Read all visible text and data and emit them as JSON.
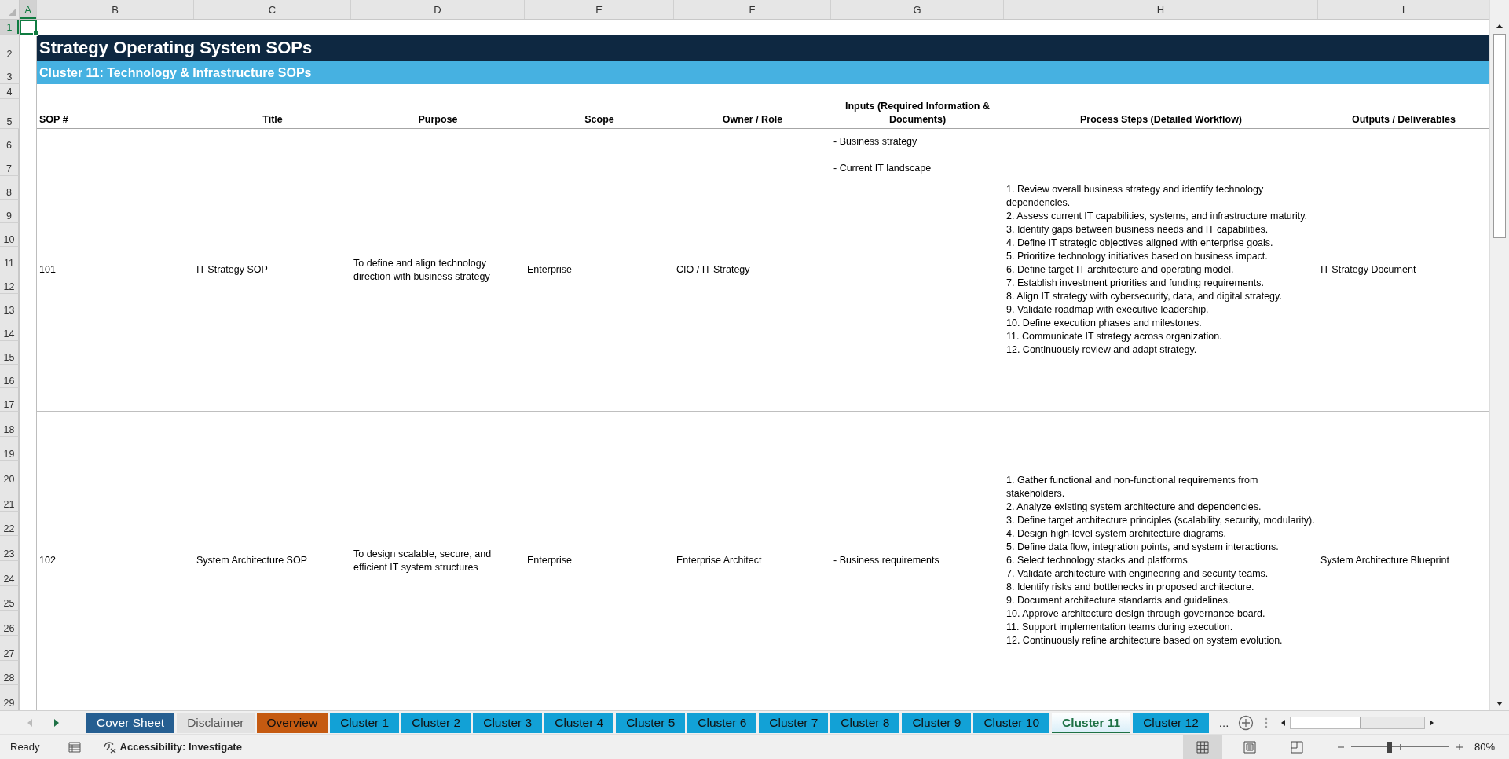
{
  "column_headers": [
    {
      "label": "A",
      "selected": true
    },
    {
      "label": "B",
      "selected": false
    },
    {
      "label": "C",
      "selected": false
    },
    {
      "label": "D",
      "selected": false
    },
    {
      "label": "E",
      "selected": false
    },
    {
      "label": "F",
      "selected": false
    },
    {
      "label": "G",
      "selected": false
    },
    {
      "label": "H",
      "selected": false
    },
    {
      "label": "I",
      "selected": false
    }
  ],
  "top_rows": [
    {
      "label": "1",
      "selected": true
    },
    {
      "label": "2",
      "selected": false
    },
    {
      "label": "3",
      "selected": false
    },
    {
      "label": "4",
      "selected": false
    },
    {
      "label": "5",
      "selected": false
    }
  ],
  "sheet": {
    "title": "Strategy Operating System SOPs",
    "subtitle": "Cluster 11: Technology & Infrastructure SOPs",
    "table": {
      "columns": [
        "SOP #",
        "Title",
        "Purpose",
        "Scope",
        "Owner / Role",
        "Inputs (Required Information & Documents)",
        "Process Steps (Detailed Workflow)",
        "Outputs / Deliverables"
      ],
      "rows": [
        {
          "row_numbers": [
            "6",
            "7",
            "8",
            "9",
            "10",
            "11",
            "12",
            "13",
            "14",
            "15",
            "16",
            "17"
          ],
          "sop": "101",
          "title": "IT Strategy SOP",
          "purpose": "To define and align technology direction with business strategy",
          "scope": "Enterprise",
          "owner": "CIO / IT Strategy",
          "inputs": [
            "- Business strategy",
            "- Current IT landscape"
          ],
          "steps": [
            "1. Review overall business strategy and identify technology dependencies.",
            "2. Assess current IT capabilities, systems, and infrastructure maturity.",
            "3. Identify gaps between business needs and IT capabilities.",
            "4. Define IT strategic objectives aligned with enterprise goals.",
            "5. Prioritize technology initiatives based on business impact.",
            "6. Define target IT architecture and operating model.",
            "7. Establish investment priorities and funding requirements.",
            "8. Align IT strategy with cybersecurity, data, and digital strategy.",
            "9. Validate roadmap with executive leadership.",
            "10. Define execution phases and milestones.",
            "11. Communicate IT strategy across organization.",
            "12. Continuously review and adapt strategy."
          ],
          "outputs": "IT Strategy Document"
        },
        {
          "row_numbers": [
            "18",
            "19",
            "20",
            "21",
            "22",
            "23",
            "24",
            "25",
            "26",
            "27",
            "28",
            "29"
          ],
          "sop": "102",
          "title": "System Architecture SOP",
          "purpose": "To design scalable, secure, and efficient IT system structures",
          "scope": "Enterprise",
          "owner": "Enterprise Architect",
          "inputs": [
            "- Business requirements"
          ],
          "steps": [
            "1. Gather functional and non-functional requirements from stakeholders.",
            "2. Analyze existing system architecture and dependencies.",
            "3. Define target architecture principles (scalability, security, modularity).",
            "4. Design high-level system architecture diagrams.",
            "5. Define data flow, integration points, and system interactions.",
            "6. Select technology stacks and platforms.",
            "7. Validate architecture with engineering and security teams.",
            "8. Identify risks and bottlenecks in proposed architecture.",
            "9. Document architecture standards and guidelines.",
            "10. Approve architecture design through governance board.",
            "11. Support implementation teams during execution.",
            "12. Continuously refine architecture based on system evolution."
          ],
          "outputs": "System Architecture Blueprint"
        }
      ]
    }
  },
  "sheet_tabs": [
    {
      "label": "Cover Sheet",
      "selected": false,
      "color": "#255e91"
    },
    {
      "label": "Disclaimer",
      "selected": false,
      "color": "#e2e2e2"
    },
    {
      "label": "Overview",
      "selected": false,
      "color": "#c55a11"
    },
    {
      "label": "Cluster 1",
      "selected": false,
      "color": "#12a1d6"
    },
    {
      "label": "Cluster 2",
      "selected": false,
      "color": "#12a1d6"
    },
    {
      "label": "Cluster 3",
      "selected": false,
      "color": "#12a1d6"
    },
    {
      "label": "Cluster 4",
      "selected": false,
      "color": "#12a1d6"
    },
    {
      "label": "Cluster 5",
      "selected": false,
      "color": "#12a1d6"
    },
    {
      "label": "Cluster 6",
      "selected": false,
      "color": "#12a1d6"
    },
    {
      "label": "Cluster 7",
      "selected": false,
      "color": "#12a1d6"
    },
    {
      "label": "Cluster 8",
      "selected": false,
      "color": "#12a1d6"
    },
    {
      "label": "Cluster 9",
      "selected": false,
      "color": "#12a1d6"
    },
    {
      "label": "Cluster 10",
      "selected": false,
      "color": "#12a1d6"
    },
    {
      "label": "Cluster 11",
      "selected": true
    },
    {
      "label": "Cluster 12",
      "selected": false,
      "color": "#12a1d6"
    }
  ],
  "more_tabs": "...",
  "status_bar": {
    "mode": "Ready",
    "accessibility": "Accessibility: Investigate",
    "views": [
      {
        "kind": "normal",
        "selected": true
      },
      {
        "kind": "page_layout",
        "selected": false
      },
      {
        "kind": "page_break",
        "selected": false
      }
    ],
    "zoom_slider": {
      "level": 0.39
    },
    "zoom": "80%"
  }
}
